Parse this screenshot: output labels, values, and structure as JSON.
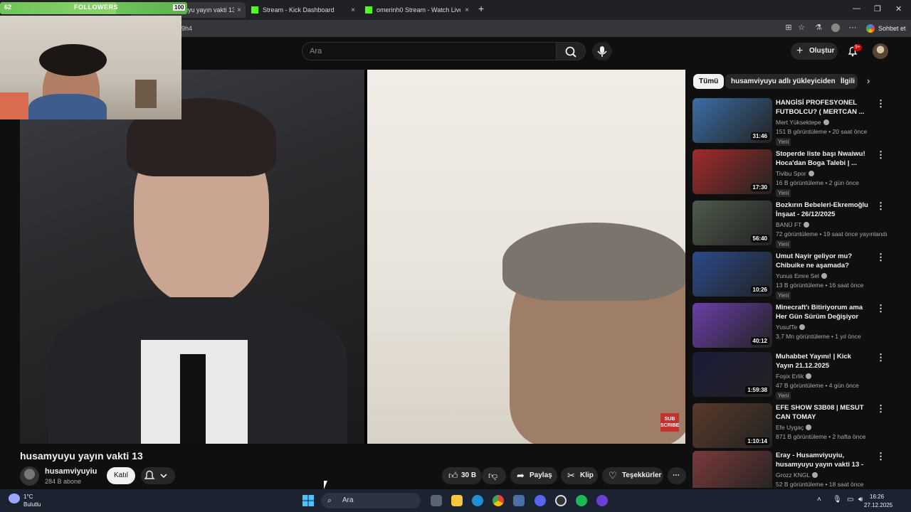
{
  "browser": {
    "tabs": [
      {
        "label": "(14) husamyuyu yayın vakti 13",
        "close": "×"
      },
      {
        "label": "Stream - Kick Dashboard",
        "close": "×"
      },
      {
        "label": "omerinh0 Stream - Watch Live on",
        "close": "×"
      }
    ],
    "new_tab": "+",
    "address": "09h4",
    "sohbet_label": "Sohbet et",
    "window_controls": [
      "—",
      "❐",
      "✕"
    ]
  },
  "overlay": {
    "followers_count": "62",
    "followers_label": "FOLLOWERS",
    "followers_goal": "100",
    "followers_progress": 0.62
  },
  "youtube": {
    "search_placeholder": "Ara",
    "create_label": "Oluştur",
    "notif_badge": "9+",
    "video_title": "husamyuyu yayın vakti 13",
    "subscribe_badge": "SUB SCRIBE",
    "channel_name": "husamviyuyiu",
    "channel_subs": "284 B abone",
    "join_label": "Katıl",
    "like_count": "30 B",
    "share_label": "Paylaş",
    "clip_label": "Klip",
    "thanks_label": "Teşekkürler",
    "more": "⋯"
  },
  "chips": [
    "Tümü",
    "husamviyuyu adlı yükleyiciden",
    "İlgili"
  ],
  "recommendations": [
    {
      "title": "HANGİSİ PROFESYONEL FUTBOLCU? ( MERTCAN ...",
      "channel": "Mert Yüksektepe",
      "meta": "151 B görüntüleme • 20 saat önce",
      "badge": "Yeni",
      "duration": "31:46",
      "color": "#3a6ea5"
    },
    {
      "title": "Stoperde liste başı Nwaiwu! Hoca'dan Boga Talebi | ...",
      "channel": "Tivibu Spor",
      "meta": "16 B görüntüleme • 2 gün önce",
      "badge": "Yeni",
      "duration": "17:30",
      "color": "#a32a2a"
    },
    {
      "title": "Bozkırın Bebeleri-Ekremoğlu İnşaat - 26/12/2025",
      "channel": "BANÜ FT",
      "meta": "72 görüntüleme • 19 saat önce yayınlandı",
      "badge": "Yeni",
      "duration": "56:40",
      "color": "#4f5a4c"
    },
    {
      "title": "Umut Nayir geliyor mu? Chibuike ne aşamada? Savic ...",
      "channel": "Yunus Emre Sel",
      "meta": "13 B görüntüleme • 16 saat önce",
      "badge": "Yeni",
      "duration": "10:26",
      "color": "#2a4a8a"
    },
    {
      "title": "Minecraft'ı Bitiriyorum ama Her Gün Sürüm Değişiyor",
      "channel": "YusufTe",
      "meta": "3,7 Mn görüntüleme • 1 yıl önce",
      "badge": "",
      "duration": "40:12",
      "color": "#6a3fa8"
    },
    {
      "title": "Muhabbet Yayını! | Kick Yayın 21.12.2025",
      "channel": "Foşix Erlik",
      "meta": "47 B görüntüleme • 4 gün önce",
      "badge": "Yeni",
      "duration": "1:59:38",
      "color": "#1b1b3a"
    },
    {
      "title": "EFE SHOW S3B08 | MESUT CAN TOMAY",
      "channel": "Efe Uygaç",
      "meta": "871 B görüntüleme • 2 hafta önce",
      "badge": "",
      "duration": "1:10:14",
      "color": "#5a3a2a"
    },
    {
      "title": "Eray - Husamviyuyiu, husamyuyu yayın vakti 13 - ...",
      "channel": "Grozz KNGL",
      "meta": "52 B görüntüleme • 18 saat önce",
      "badge": "",
      "duration": "",
      "color": "#7a3a3a"
    }
  ],
  "taskbar": {
    "temp": "1°C",
    "weather": "Bulutlu",
    "search": "Ara",
    "time": "16:26",
    "date": "27.12.2025"
  }
}
